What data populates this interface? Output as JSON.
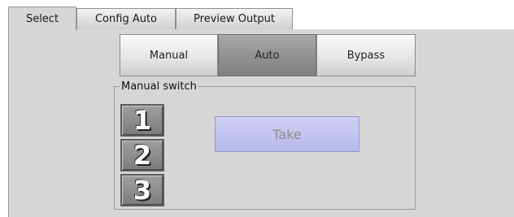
{
  "tabs": [
    {
      "label": "Select",
      "active": true
    },
    {
      "label": "Config Auto",
      "active": false
    },
    {
      "label": "Preview Output",
      "active": false
    }
  ],
  "mode_buttons": [
    {
      "label": "Manual",
      "selected": false
    },
    {
      "label": "Auto",
      "selected": true
    },
    {
      "label": "Bypass",
      "selected": false
    }
  ],
  "manual_switch": {
    "legend": "Manual switch",
    "inputs": [
      "1",
      "2",
      "3"
    ],
    "take_label": "Take",
    "take_enabled": false
  },
  "colors": {
    "panel_bg": "#d6d6d6",
    "selected_mode": "#909090",
    "take_bg": "#c4c4f0",
    "take_text_disabled": "#8d8d8d"
  }
}
